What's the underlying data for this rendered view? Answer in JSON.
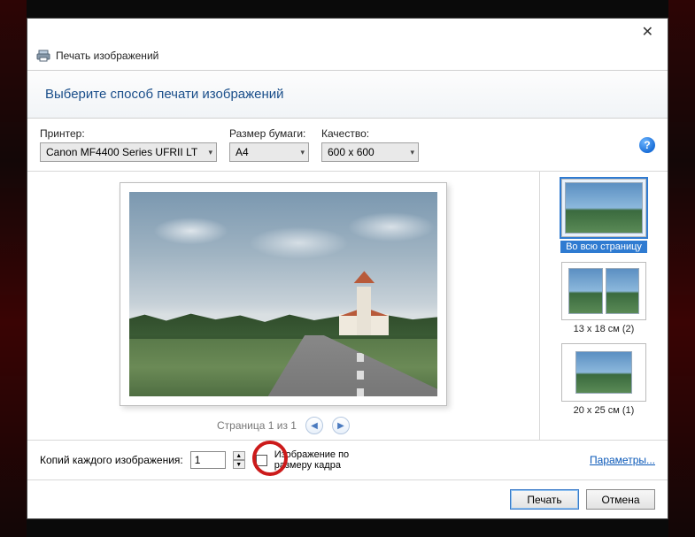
{
  "window": {
    "title": "Печать изображений",
    "instruction": "Выберите способ печати изображений"
  },
  "fields": {
    "printer": {
      "label": "Принтер:",
      "value": "Canon MF4400 Series UFRII LT"
    },
    "paper": {
      "label": "Размер бумаги:",
      "value": "A4"
    },
    "quality": {
      "label": "Качество:",
      "value": "600 x 600"
    }
  },
  "pager": {
    "text": "Страница 1 из 1"
  },
  "layouts": [
    {
      "key": "full",
      "label": "Во всю страницу",
      "selected": true,
      "thumbs": 1
    },
    {
      "key": "two",
      "label": "13 x 18 см (2)",
      "selected": false,
      "thumbs": 2
    },
    {
      "key": "one2025",
      "label": "20 x 25 см (1)",
      "selected": false,
      "thumbs": 1
    }
  ],
  "copies": {
    "label": "Копий каждого изображения:",
    "value": "1",
    "fit_label": "Изображение по размеру кадра",
    "fit_checked": false
  },
  "links": {
    "params": "Параметры..."
  },
  "buttons": {
    "print": "Печать",
    "cancel": "Отмена"
  },
  "icons": {
    "help": "?"
  }
}
